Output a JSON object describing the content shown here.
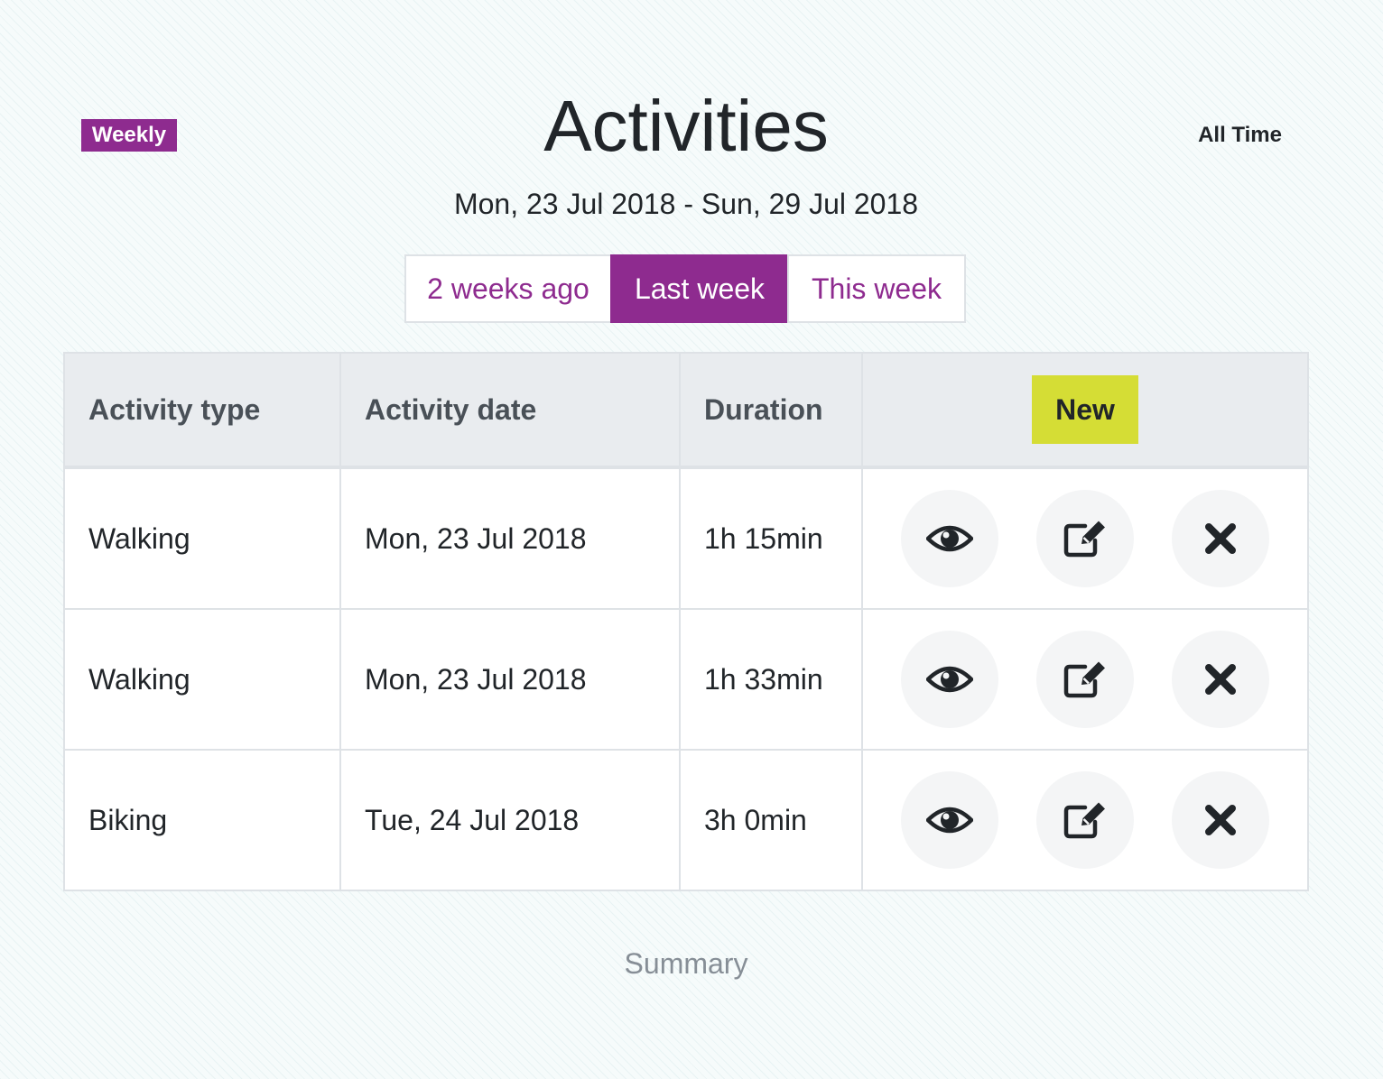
{
  "header": {
    "weekly_label": "Weekly",
    "title": "Activities",
    "all_time_label": "All Time",
    "date_range": "Mon, 23 Jul 2018 - Sun, 29 Jul 2018"
  },
  "tabs": [
    {
      "label": "2 weeks ago",
      "active": false
    },
    {
      "label": "Last week",
      "active": true
    },
    {
      "label": "This week",
      "active": false
    }
  ],
  "table": {
    "columns": [
      "Activity type",
      "Activity date",
      "Duration"
    ],
    "new_label": "New",
    "rows": [
      {
        "type": "Walking",
        "date": "Mon, 23 Jul 2018",
        "duration": "1h 15min"
      },
      {
        "type": "Walking",
        "date": "Mon, 23 Jul 2018",
        "duration": "1h 33min"
      },
      {
        "type": "Biking",
        "date": "Tue, 24 Jul 2018",
        "duration": "3h 0min"
      }
    ],
    "row_action_icons": [
      "eye-icon",
      "edit-icon",
      "close-icon"
    ]
  },
  "footer": {
    "summary_label": "Summary"
  },
  "colors": {
    "brand": "#8e2b8f",
    "new_button": "#d5dd35",
    "header_bg": "#e9ecef",
    "muted_text": "#868e96"
  }
}
